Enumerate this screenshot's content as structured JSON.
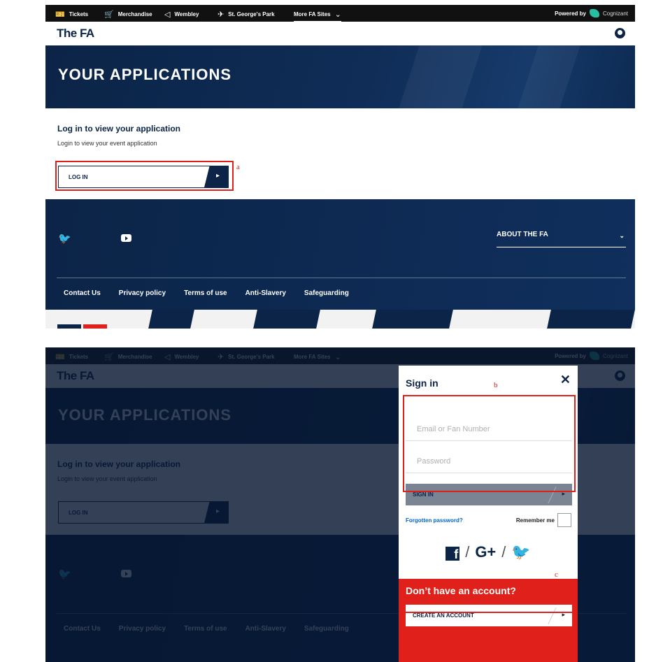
{
  "topbar": {
    "items": [
      {
        "label": "Tickets",
        "icon": "ticket-icon"
      },
      {
        "label": "Merchandise",
        "icon": "cart-icon"
      },
      {
        "label": "Wembley",
        "icon": "stadium-icon"
      },
      {
        "label": "St. George's Park",
        "icon": "plane-icon"
      },
      {
        "label": "More FA Sites",
        "icon": "chevron-down-icon"
      }
    ],
    "powered_by": "Powered by",
    "sponsor": "Cognizant"
  },
  "brand": {
    "logo": "The FA"
  },
  "hero": {
    "title": "YOUR APPLICATIONS"
  },
  "login_section": {
    "heading": "Log in to view your application",
    "subtext": "Login to view your event application",
    "button_label": "LOG IN"
  },
  "footer": {
    "about_label": "ABOUT THE FA",
    "links": [
      "Contact Us",
      "Privacy policy",
      "Terms of use",
      "Anti-Slavery",
      "Safeguarding"
    ]
  },
  "modal": {
    "title": "Sign in",
    "close": "✕",
    "email_placeholder": "Email or Fan Number",
    "password_placeholder": "Password",
    "sign_in_label": "SIGN IN",
    "forgot_label": "Forgotten password?",
    "remember_label": "Remember me",
    "social_separator": "/",
    "google_label": "G+",
    "no_account_title": "Don’t have an account?",
    "create_account_label": "CREATE AN ACCOUNT"
  },
  "annotations": {
    "a": "a",
    "b": "b",
    "c": "c"
  },
  "colors": {
    "navy": "#0b2447",
    "red": "#e0211b",
    "annotation": "#e0211b"
  }
}
